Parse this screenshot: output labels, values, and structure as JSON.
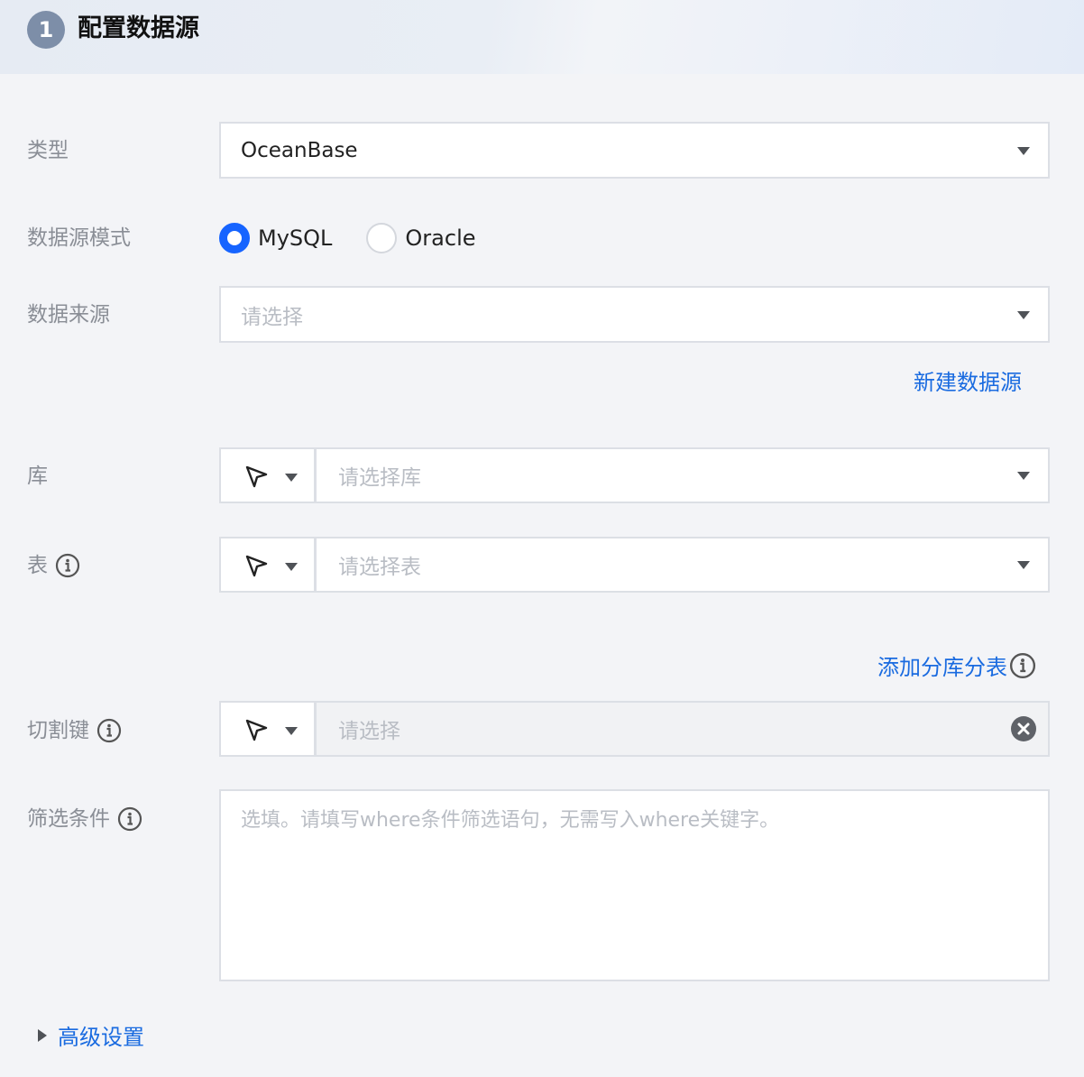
{
  "section": {
    "step": "1",
    "title": "配置数据源"
  },
  "fields": {
    "type": {
      "label": "类型",
      "value": "OceanBase"
    },
    "mode": {
      "label": "数据源模式",
      "options": [
        "MySQL",
        "Oracle"
      ],
      "selected": "MySQL"
    },
    "source": {
      "label": "数据来源",
      "placeholder": "请选择",
      "link": "新建数据源"
    },
    "database": {
      "label": "库",
      "placeholder": "请选择库"
    },
    "table": {
      "label": "表",
      "placeholder": "请选择表",
      "link": "添加分库分表"
    },
    "split_key": {
      "label": "切割键",
      "placeholder": "请选择"
    },
    "filter": {
      "label": "筛选条件",
      "placeholder": "选填。请填写where条件筛选语句，无需写入where关键字。"
    }
  },
  "advanced": {
    "label": "高级设置"
  },
  "colors": {
    "accent": "#1664ff",
    "link": "#1a6be0",
    "badge": "#7d8ea8"
  },
  "icons": [
    "info-icon",
    "cursor-icon",
    "chevron-down-icon",
    "clear-icon",
    "caret-right-icon"
  ]
}
